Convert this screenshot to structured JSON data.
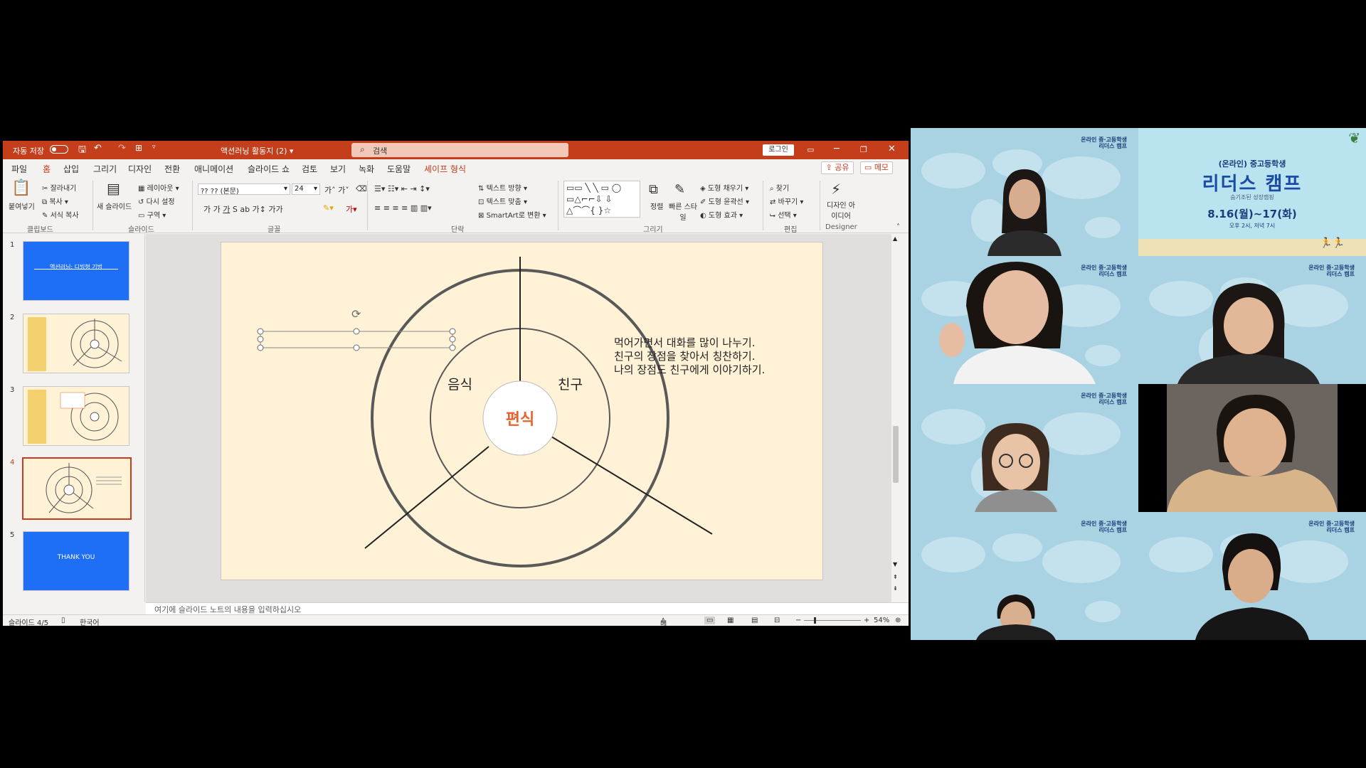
{
  "powerpoint": {
    "titlebar": {
      "autosave_label": "자동 저장",
      "doc_title": "액션러닝 활동지 (2) ▾",
      "search_placeholder": "검색",
      "login_label": "로그인"
    },
    "tabs": [
      "파일",
      "홈",
      "삽입",
      "그리기",
      "디자인",
      "전환",
      "애니메이션",
      "슬라이드 쇼",
      "검토",
      "보기",
      "녹화",
      "도움말",
      "셰이프 형식"
    ],
    "share_label": "공유",
    "memo_label": "메모",
    "ribbon": {
      "clipboard": {
        "paste": "붙여넣기",
        "cut": "잘라내기",
        "copy": "복사",
        "format_painter": "서식 복사",
        "group": "클립보드"
      },
      "slides": {
        "new_slide": "새 슬라이드",
        "layout": "레이아웃",
        "reset": "다시 설정",
        "section": "구역",
        "group": "슬라이드"
      },
      "font": {
        "name": "?? ?? (본문)",
        "size": "24",
        "group": "글꼴"
      },
      "paragraph": {
        "text_direction": "텍스트 방향",
        "align_text": "텍스트 맞춤",
        "smartart": "SmartArt로 변환",
        "group": "단락"
      },
      "drawing": {
        "arrange": "정렬",
        "quick_styles": "빠른 스타일",
        "shape_fill": "도형 채우기",
        "shape_outline": "도형 윤곽선",
        "shape_effects": "도형 효과",
        "group": "그리기"
      },
      "editing": {
        "find": "찾기",
        "replace": "바꾸기",
        "select": "선택",
        "group": "편집"
      },
      "designer": {
        "ideas": "디자인 아이디어",
        "group": "Designer"
      }
    },
    "thumbnails": [
      {
        "num": "1",
        "title": "액션러닝: 디빙형 기법"
      },
      {
        "num": "2"
      },
      {
        "num": "3"
      },
      {
        "num": "4"
      },
      {
        "num": "5",
        "title": "THANK YOU"
      }
    ],
    "slide": {
      "center_label": "편식",
      "left_label": "음식",
      "right_label": "친구",
      "text_lines": [
        "먹어가면서 대화를 많이 나누기.",
        "친구의 장점을 찾아서 칭찬하기.",
        "나의 장점도 친구에게 이야기하기."
      ],
      "colors": {
        "background": "#fff2d6",
        "center_text": "#e8622b",
        "ring": "#595959"
      }
    },
    "notes_placeholder": "여기에 슬라이드 노트의 내용을 입력하십시오",
    "status": {
      "slide_counter": "슬라이드 4/5",
      "language": "한국어",
      "notes": "메모",
      "zoom": "54%"
    }
  },
  "video_grid": {
    "watermark_line1": "온라인 중·고등학생",
    "watermark_line2": "리더스 캠프",
    "banner": {
      "top": "(온라인) 중고등학생",
      "title": "리더스 캠프",
      "subtitle": "숨기조된 성장캠핑",
      "date": "8.16(월)~17(화)",
      "time": "오후 2시, 저녁 7시"
    }
  }
}
